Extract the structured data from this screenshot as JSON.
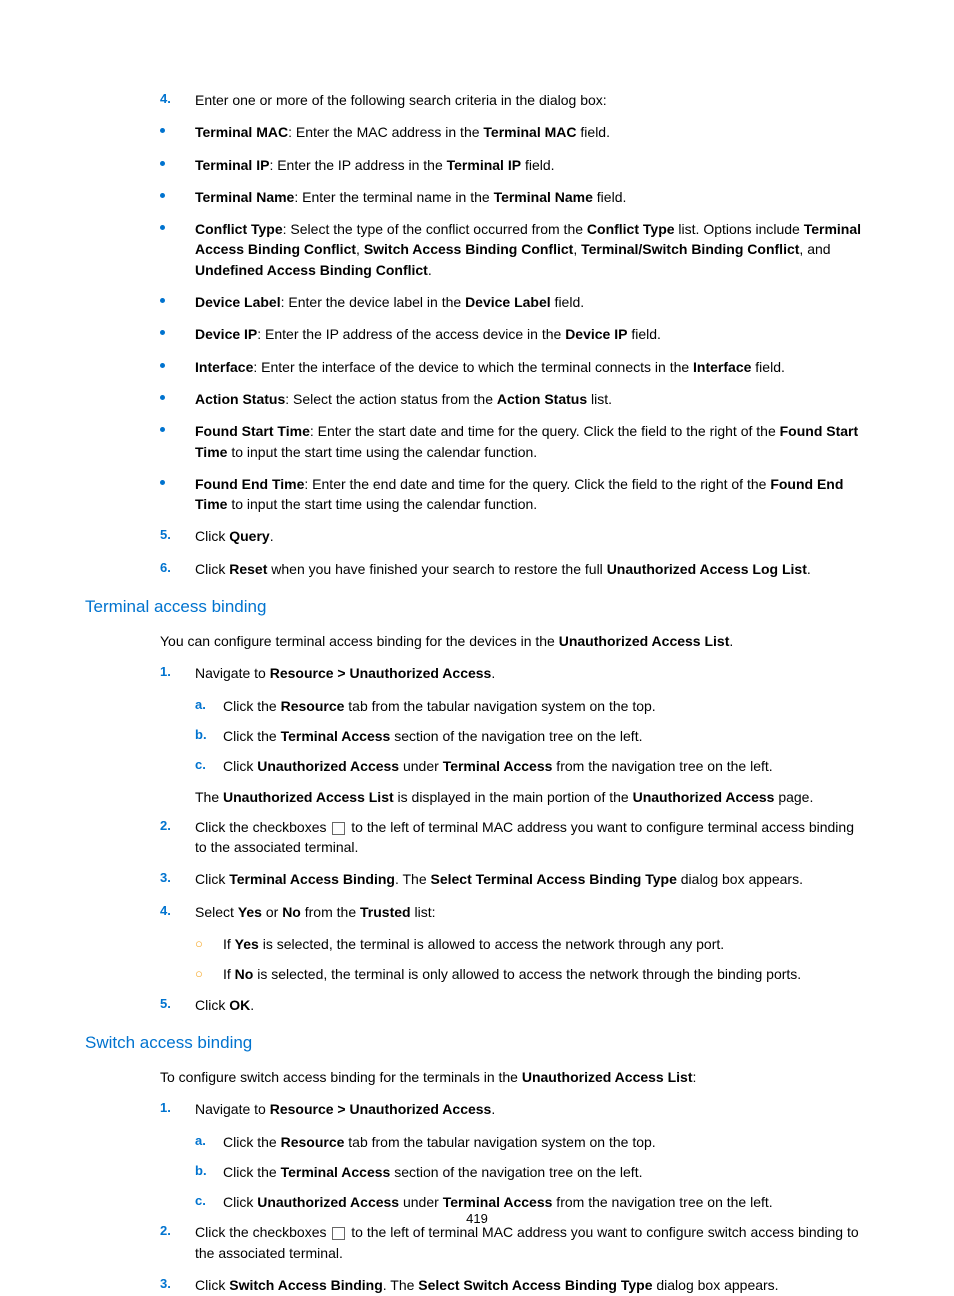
{
  "pagenum": "419",
  "s0": {
    "n4": "4.",
    "t4": "Enter one or more of the following search criteria in the dialog box:",
    "b1": {
      "p": [
        [
          "b",
          "Terminal MAC"
        ],
        [
          "",
          ": Enter the MAC address in the "
        ],
        [
          "b",
          "Terminal MAC"
        ],
        [
          "",
          " field."
        ]
      ]
    },
    "b2": {
      "p": [
        [
          "b",
          "Terminal IP"
        ],
        [
          "",
          ": Enter the IP address in the "
        ],
        [
          "b",
          "Terminal IP"
        ],
        [
          "",
          " field."
        ]
      ]
    },
    "b3": {
      "p": [
        [
          "b",
          "Terminal Name"
        ],
        [
          "",
          ": Enter the terminal name in the "
        ],
        [
          "b",
          "Terminal Name"
        ],
        [
          "",
          " field."
        ]
      ]
    },
    "b4": {
      "p": [
        [
          "b",
          "Conflict Type"
        ],
        [
          "",
          ": Select the type of the conflict occurred from the "
        ],
        [
          "b",
          "Conflict Type"
        ],
        [
          "",
          " list. Options include "
        ],
        [
          "b",
          "Terminal Access Binding Conflict"
        ],
        [
          "",
          ", "
        ],
        [
          "b",
          "Switch Access Binding Conflict"
        ],
        [
          "",
          ", "
        ],
        [
          "b",
          "Terminal/Switch Binding Conflict"
        ],
        [
          "",
          ", and "
        ],
        [
          "b",
          "Undefined Access Binding Conflict"
        ],
        [
          "",
          "."
        ]
      ]
    },
    "b5": {
      "p": [
        [
          "b",
          "Device Label"
        ],
        [
          "",
          ": Enter the device label in the "
        ],
        [
          "b",
          "Device Label"
        ],
        [
          "",
          " field."
        ]
      ]
    },
    "b6": {
      "p": [
        [
          "b",
          "Device IP"
        ],
        [
          "",
          ": Enter the IP address of the access device in the "
        ],
        [
          "b",
          "Device IP"
        ],
        [
          "",
          " field."
        ]
      ]
    },
    "b7": {
      "p": [
        [
          "b",
          "Interface"
        ],
        [
          "",
          ": Enter the interface of the device to which the terminal connects in the "
        ],
        [
          "b",
          "Interface"
        ],
        [
          "",
          " field."
        ]
      ]
    },
    "b8": {
      "p": [
        [
          "b",
          "Action Status"
        ],
        [
          "",
          ": Select the action status from the "
        ],
        [
          "b",
          "Action Status"
        ],
        [
          "",
          " list."
        ]
      ]
    },
    "b9": {
      "p": [
        [
          "b",
          "Found Start Time"
        ],
        [
          "",
          ": Enter the start date and time for the query. Click the field to the right of the "
        ],
        [
          "b",
          "Found Start Time"
        ],
        [
          "",
          " to input the start time using the calendar function."
        ]
      ]
    },
    "b10": {
      "p": [
        [
          "b",
          "Found End Time"
        ],
        [
          "",
          ": Enter the end date and time for the query. Click the field to the right of the "
        ],
        [
          "b",
          "Found End Time"
        ],
        [
          "",
          " to input the start time using the calendar function."
        ]
      ]
    },
    "n5": "5.",
    "t5": {
      "p": [
        [
          "",
          "Click "
        ],
        [
          "b",
          "Query"
        ],
        [
          "",
          "."
        ]
      ]
    },
    "n6": "6.",
    "t6": {
      "p": [
        [
          "",
          "Click "
        ],
        [
          "b",
          "Reset"
        ],
        [
          "",
          " when you have finished your search to restore the full "
        ],
        [
          "b",
          "Unauthorized Access Log List"
        ],
        [
          "",
          "."
        ]
      ]
    }
  },
  "s1": {
    "h": "Terminal access binding",
    "intro": {
      "p": [
        [
          "",
          "You can configure terminal access binding for the devices in the "
        ],
        [
          "b",
          "Unauthorized Access List"
        ],
        [
          "",
          "."
        ]
      ]
    },
    "n1": "1.",
    "t1": {
      "p": [
        [
          "",
          "Navigate to "
        ],
        [
          "b",
          "Resource > Unauthorized Access"
        ],
        [
          "",
          "."
        ]
      ]
    },
    "a": "a.",
    "ta": {
      "p": [
        [
          "",
          "Click the "
        ],
        [
          "b",
          "Resource"
        ],
        [
          "",
          " tab from the tabular navigation system on the top."
        ]
      ]
    },
    "b": "b.",
    "tb": {
      "p": [
        [
          "",
          "Click the "
        ],
        [
          "b",
          "Terminal Access"
        ],
        [
          "",
          " section of the navigation tree on the left."
        ]
      ]
    },
    "c": "c.",
    "tc": {
      "p": [
        [
          "",
          "Click "
        ],
        [
          "b",
          "Unauthorized Access"
        ],
        [
          "",
          " under "
        ],
        [
          "b",
          "Terminal Access"
        ],
        [
          "",
          " from the navigation tree on the left."
        ]
      ]
    },
    "note": {
      "p": [
        [
          "",
          "The "
        ],
        [
          "b",
          "Unauthorized Access List"
        ],
        [
          "",
          " is displayed in the main portion of the "
        ],
        [
          "b",
          "Unauthorized Access"
        ],
        [
          "",
          " page."
        ]
      ]
    },
    "n2": "2.",
    "t2": {
      "p": [
        [
          "",
          "Click the checkboxes "
        ],
        [
          "cb",
          ""
        ],
        [
          "",
          " to the left of terminal MAC address you want to configure terminal access binding to the associated terminal."
        ]
      ]
    },
    "n3": "3.",
    "t3": {
      "p": [
        [
          "",
          "Click "
        ],
        [
          "b",
          "Terminal Access Binding"
        ],
        [
          "",
          ". The "
        ],
        [
          "b",
          "Select Terminal Access Binding Type"
        ],
        [
          "",
          " dialog box appears."
        ]
      ]
    },
    "n4": "4.",
    "t4": {
      "p": [
        [
          "",
          "Select "
        ],
        [
          "b",
          "Yes"
        ],
        [
          "",
          " or "
        ],
        [
          "b",
          "No"
        ],
        [
          "",
          " from the "
        ],
        [
          "b",
          "Trusted"
        ],
        [
          "",
          " list:"
        ]
      ]
    },
    "c1": {
      "p": [
        [
          "",
          "If "
        ],
        [
          "b",
          "Yes"
        ],
        [
          "",
          " is selected, the terminal is allowed to access the network through any port."
        ]
      ]
    },
    "c2": {
      "p": [
        [
          "",
          "If "
        ],
        [
          "b",
          "No"
        ],
        [
          "",
          " is selected, the terminal is only allowed to access the network through the binding ports."
        ]
      ]
    },
    "n5": "5.",
    "t5": {
      "p": [
        [
          "",
          "Click "
        ],
        [
          "b",
          "OK"
        ],
        [
          "",
          "."
        ]
      ]
    }
  },
  "s2": {
    "h": "Switch access binding",
    "intro": {
      "p": [
        [
          "",
          "To configure switch access binding for the terminals in the "
        ],
        [
          "b",
          "Unauthorized Access List"
        ],
        [
          "",
          ":"
        ]
      ]
    },
    "n1": "1.",
    "t1": {
      "p": [
        [
          "",
          "Navigate to "
        ],
        [
          "b",
          "Resource > Unauthorized Access"
        ],
        [
          "",
          "."
        ]
      ]
    },
    "a": "a.",
    "ta": {
      "p": [
        [
          "",
          "Click the "
        ],
        [
          "b",
          "Resource"
        ],
        [
          "",
          " tab from the tabular navigation system on the top."
        ]
      ]
    },
    "b": "b.",
    "tb": {
      "p": [
        [
          "",
          "Click the "
        ],
        [
          "b",
          "Terminal Access"
        ],
        [
          "",
          " section of the navigation tree on the left."
        ]
      ]
    },
    "c": "c.",
    "tc": {
      "p": [
        [
          "",
          "Click "
        ],
        [
          "b",
          "Unauthorized Access"
        ],
        [
          "",
          " under "
        ],
        [
          "b",
          "Terminal Access"
        ],
        [
          "",
          " from the navigation tree on the left."
        ]
      ]
    },
    "n2": "2.",
    "t2": {
      "p": [
        [
          "",
          "Click the checkboxes "
        ],
        [
          "cb",
          ""
        ],
        [
          "",
          " to the left of terminal MAC address you want to configure switch access binding to the associated terminal."
        ]
      ]
    },
    "n3": "3.",
    "t3": {
      "p": [
        [
          "",
          "Click "
        ],
        [
          "b",
          "Switch Access Binding"
        ],
        [
          "",
          ". The "
        ],
        [
          "b",
          "Select Switch Access Binding Type"
        ],
        [
          "",
          " dialog box appears."
        ]
      ]
    }
  }
}
